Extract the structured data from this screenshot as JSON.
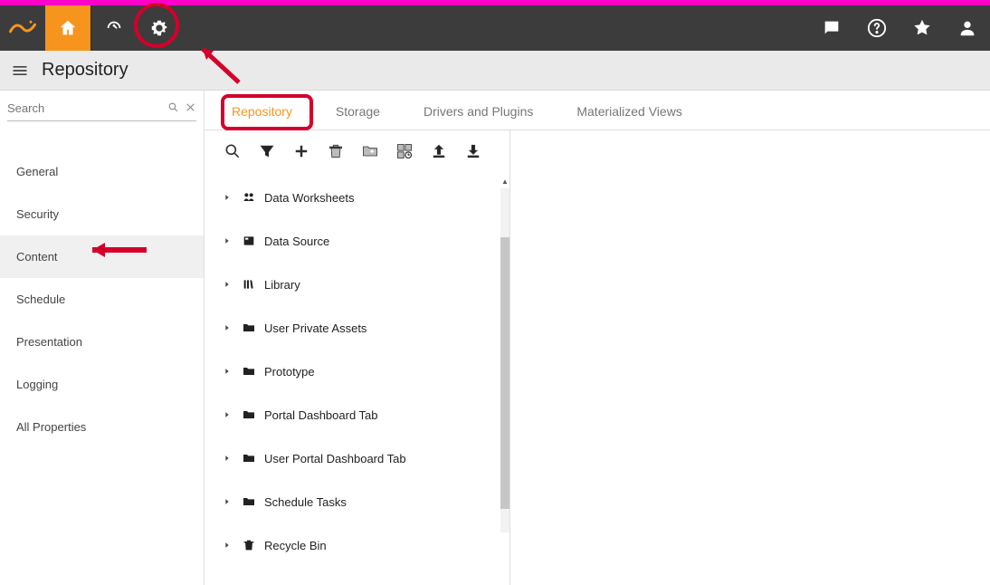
{
  "page": {
    "title": "Repository"
  },
  "topnav": {
    "icons": [
      "home",
      "gauge",
      "gear",
      "chat",
      "help",
      "star",
      "account"
    ]
  },
  "search": {
    "placeholder": "Search"
  },
  "sidebar": {
    "items": [
      {
        "label": "General"
      },
      {
        "label": "Security"
      },
      {
        "label": "Content",
        "active": true
      },
      {
        "label": "Schedule"
      },
      {
        "label": "Presentation"
      },
      {
        "label": "Logging"
      },
      {
        "label": "All Properties"
      }
    ]
  },
  "tabs": [
    {
      "label": "Repository",
      "active": true
    },
    {
      "label": "Storage"
    },
    {
      "label": "Drivers and Plugins"
    },
    {
      "label": "Materialized Views"
    }
  ],
  "toolbar_icons": [
    {
      "name": "search",
      "enabled": true
    },
    {
      "name": "filter",
      "enabled": true
    },
    {
      "name": "add",
      "enabled": true
    },
    {
      "name": "trash",
      "enabled": false
    },
    {
      "name": "folder-move",
      "enabled": false
    },
    {
      "name": "grid-time",
      "enabled": false
    },
    {
      "name": "upload",
      "enabled": true
    },
    {
      "name": "download",
      "enabled": true
    }
  ],
  "tree": [
    {
      "icon": "worksheet",
      "label": "Data Worksheets"
    },
    {
      "icon": "datasource",
      "label": "Data Source"
    },
    {
      "icon": "library",
      "label": "Library"
    },
    {
      "icon": "folder",
      "label": "User Private Assets"
    },
    {
      "icon": "folder",
      "label": "Prototype"
    },
    {
      "icon": "folder",
      "label": "Portal Dashboard Tab"
    },
    {
      "icon": "folder",
      "label": "User Portal Dashboard Tab"
    },
    {
      "icon": "folder",
      "label": "Schedule Tasks"
    },
    {
      "icon": "recycle",
      "label": "Recycle Bin"
    }
  ],
  "annotations": {
    "gear_circle": true,
    "arrow_to_gear": true,
    "repository_tab_rect": true,
    "arrow_to_content": true
  },
  "colors": {
    "accent": "#f7941d",
    "annotation": "#d4002a",
    "magenta": "#ff00c8",
    "topnav": "#3c3c3c"
  }
}
